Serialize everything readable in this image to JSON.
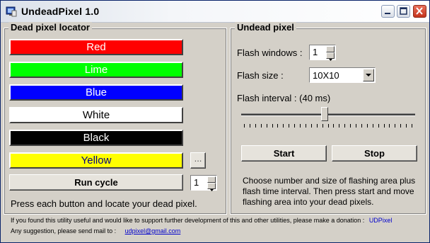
{
  "window": {
    "title": "UndeadPixel 1.0",
    "controls": [
      "minimize",
      "maximize",
      "close"
    ]
  },
  "locator": {
    "group_title": "Dead pixel locator",
    "color_buttons": [
      {
        "label": "Red",
        "bg": "#ff0000",
        "fg": "#ffffff"
      },
      {
        "label": "Lime",
        "bg": "#00ff00",
        "fg": "#ffffff"
      },
      {
        "label": "Blue",
        "bg": "#0000ff",
        "fg": "#ffffff"
      },
      {
        "label": "White",
        "bg": "#ffffff",
        "fg": "#000000"
      },
      {
        "label": "Black",
        "bg": "#000000",
        "fg": "#ffffff"
      },
      {
        "label": "Yellow",
        "bg": "#ffff00",
        "fg": "#000080"
      }
    ],
    "more_button": "...",
    "run_cycle_label": "Run cycle",
    "cycle_count": "1",
    "hint": "Press each button and locate your dead pixel."
  },
  "undead": {
    "group_title": "Undead pixel",
    "flash_windows_label": "Flash windows :",
    "flash_windows_value": "1",
    "flash_size_label": "Flash size :",
    "flash_size_value": "10X10",
    "flash_interval_label": "Flash interval : (40 ms)",
    "slider_value_fraction": 0.48,
    "start_label": "Start",
    "stop_label": "Stop",
    "instructions": "Choose number and size of flashing area plus flash time interval. Then press start and move flashing area into your dead pixels."
  },
  "footer": {
    "support_text": "If you found this utility useful and would like to support further development of this and other utilities, please make a donation :",
    "donate_link": "UDPixel",
    "suggestion_text": "Any suggestion, please send mail to :",
    "email": "udpixel@gmail.com"
  }
}
